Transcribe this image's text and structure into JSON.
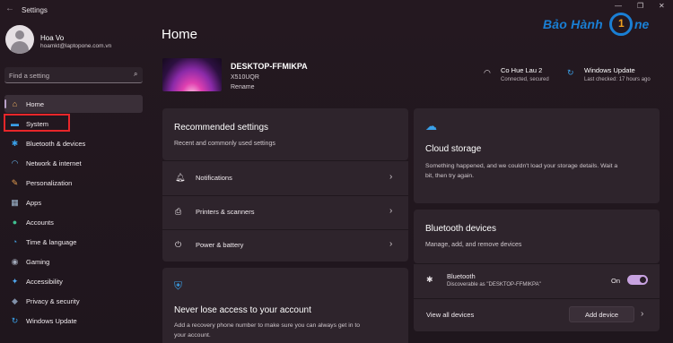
{
  "window": {
    "title": "Settings",
    "back_icon": "back-arrow-icon",
    "controls": {
      "minimize": "—",
      "maximize": "❐",
      "close": "✕"
    }
  },
  "watermark": {
    "text_left": "Bảo Hành",
    "digit": "1",
    "text_right": "ne"
  },
  "profile": {
    "name": "Hoa Vo",
    "email": "hoamkt@laptopone.com.vn"
  },
  "search": {
    "placeholder": "Find a setting",
    "value": "",
    "icon": "search-icon"
  },
  "nav": {
    "items": [
      {
        "label": "Home",
        "icon": "home-icon",
        "glyph": "⌂",
        "color": "#f0b060"
      },
      {
        "label": "System",
        "icon": "system-icon",
        "glyph": "▬",
        "color": "#3aa0e8"
      },
      {
        "label": "Bluetooth & devices",
        "icon": "bluetooth-icon",
        "glyph": "✱",
        "color": "#3aa0e8"
      },
      {
        "label": "Network & internet",
        "icon": "wifi-icon",
        "glyph": "◠",
        "color": "#6ab8f0"
      },
      {
        "label": "Personalization",
        "icon": "brush-icon",
        "glyph": "✎",
        "color": "#e8a050"
      },
      {
        "label": "Apps",
        "icon": "apps-icon",
        "glyph": "▦",
        "color": "#a0b8d0"
      },
      {
        "label": "Accounts",
        "icon": "accounts-icon",
        "glyph": "●",
        "color": "#40c090"
      },
      {
        "label": "Time & language",
        "icon": "globe-clock-icon",
        "glyph": "◔",
        "color": "#40a0e0"
      },
      {
        "label": "Gaming",
        "icon": "gamepad-icon",
        "glyph": "◉",
        "color": "#a0a8b8"
      },
      {
        "label": "Accessibility",
        "icon": "accessibility-icon",
        "glyph": "✦",
        "color": "#50a8f0"
      },
      {
        "label": "Privacy & security",
        "icon": "shield-icon",
        "glyph": "◆",
        "color": "#8090a8"
      },
      {
        "label": "Windows Update",
        "icon": "update-icon",
        "glyph": "↻",
        "color": "#3aa0e8"
      }
    ]
  },
  "main": {
    "title": "Home",
    "device": {
      "name": "DESKTOP-FFMIKPA",
      "model": "X510UQR",
      "rename": "Rename"
    },
    "status": {
      "network": {
        "title": "Co Hue Lau 2",
        "sub": "Connected, secured",
        "icon": "wifi-icon"
      },
      "update": {
        "title": "Windows Update",
        "sub": "Last checked: 17 hours ago",
        "icon": "update-icon"
      }
    },
    "recommended": {
      "title": "Recommended settings",
      "sub": "Recent and commonly used settings",
      "rows": [
        {
          "label": "Notifications",
          "icon": "bell-icon",
          "glyph": "🔔︎"
        },
        {
          "label": "Printers & scanners",
          "icon": "printer-icon",
          "glyph": "⎙"
        },
        {
          "label": "Power & battery",
          "icon": "power-icon",
          "glyph": "⏻"
        }
      ]
    },
    "account_card": {
      "title": "Never lose access to your account",
      "sub1": "Add a recovery phone number to make sure you can always get in to",
      "sub2": "your account.",
      "icon": "shield-check-icon"
    },
    "cloud": {
      "title": "Cloud storage",
      "sub1": "Something happened, and we couldn't load your storage details. Wait a",
      "sub2": "bit, then try again.",
      "icon": "cloud-icon"
    },
    "bluetooth_card": {
      "title": "Bluetooth devices",
      "sub": "Manage, add, and remove devices",
      "row_title": "Bluetooth",
      "row_sub": "Discoverable as \"DESKTOP-FFMIKPA\"",
      "toggle_label": "On",
      "toggle_state": true,
      "view_all": "View all devices",
      "add_device": "Add device"
    }
  },
  "colors": {
    "accent": "#c7a2e0",
    "highlight": "#e8262a",
    "background": "#22171f",
    "card": "#2e242c"
  }
}
